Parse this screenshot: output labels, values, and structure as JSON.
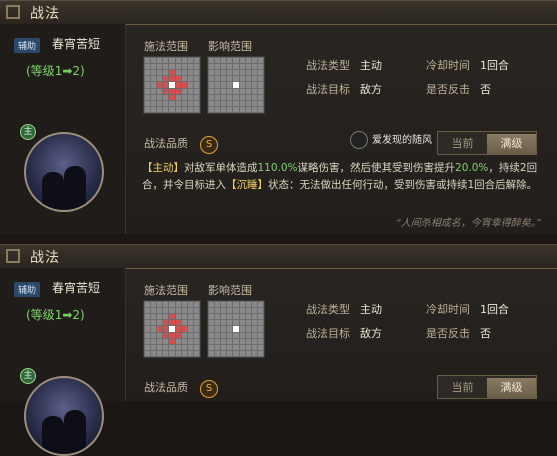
{
  "panels": [
    {
      "title": "战法",
      "hero": {
        "tag": "辅助",
        "name": "春宵苦短",
        "level_from": "1",
        "level_to": "2",
        "level_open": "(等级",
        "level_close": ")",
        "badge": "主"
      },
      "range_labels": {
        "cast": "施法范围",
        "effect": "影响范围"
      },
      "attributes": {
        "type_k": "战法类型",
        "type_v": "主动",
        "cd_k": "冷却时间",
        "cd_v": "1回合",
        "target_k": "战法目标",
        "target_v": "敌方",
        "counter_k": "是否反击",
        "counter_v": "否"
      },
      "quality_label": "战法品质",
      "quality_grade": "S",
      "tabs": {
        "current": "当前",
        "max": "满级"
      },
      "watermark": "爱发现的随风",
      "description": {
        "p1": "【主动】",
        "p2": "对敌军单体造成",
        "p3": "110.0%",
        "p4": "谋略伤害，然后使其受到伤害提升",
        "p5": "20.0%",
        "p6": "，持续2回合，并令目标进入",
        "p7": "【沉睡】",
        "p8": "状态：无法做出任何行动，受到伤害或持续1回合后解除。"
      },
      "quote": "“人间杀相成名，今宵幸得醉矣。”"
    },
    {
      "title": "战法",
      "hero": {
        "tag": "辅助",
        "name": "春宵苦短",
        "level_from": "1",
        "level_to": "2",
        "level_open": "(等级",
        "level_close": ")",
        "badge": "主"
      },
      "range_labels": {
        "cast": "施法范围",
        "effect": "影响范围"
      },
      "attributes": {
        "type_k": "战法类型",
        "type_v": "主动",
        "cd_k": "冷却时间",
        "cd_v": "1回合",
        "target_k": "战法目标",
        "target_v": "敌方",
        "counter_k": "是否反击",
        "counter_v": "否"
      },
      "quality_label": "战法品质",
      "quality_grade": "S",
      "tabs": {
        "current": "当前",
        "max": "满级"
      }
    }
  ],
  "colors": {
    "accent_gold": "#e0a23a",
    "range_red": "#d45050",
    "level_green": "#7fd36a"
  }
}
